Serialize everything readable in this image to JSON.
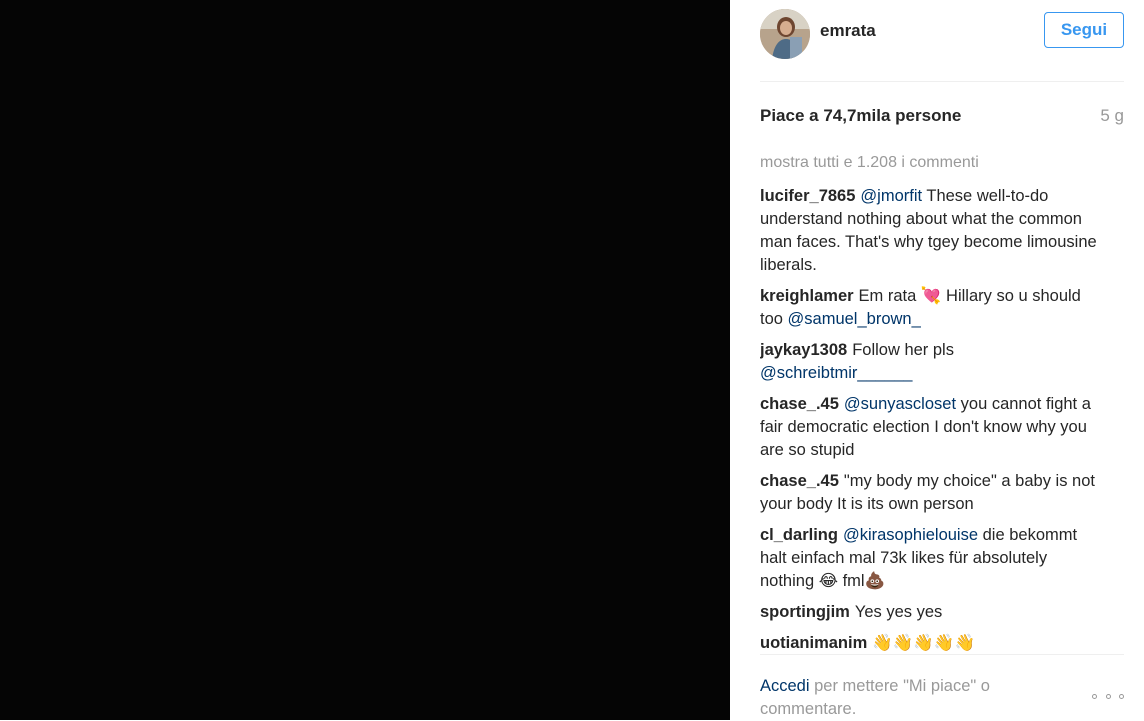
{
  "post": {
    "username": "emrata",
    "follow_label": "Segui",
    "likes": "Piace a 74,7mila persone",
    "age": "5 g",
    "show_all_comments": "mostra tutti e 1.208 i commenti"
  },
  "comments": [
    {
      "user": "lucifer_7865",
      "mention": "@jmorfit",
      "text": "These well-to-do understand nothing about what the common man faces. That's why tgey become limousine liberals."
    },
    {
      "user": "kreighlamer",
      "text": "Em rata 💘 Hillary so u should too",
      "mention_after": "@samuel_brown_"
    },
    {
      "user": "jaykay1308",
      "text": "Follow her pls",
      "mention_after": "@schreibtmir______"
    },
    {
      "user": "chase_.45",
      "mention": "@sunyascloset",
      "text": "you cannot fight a fair democratic election I don't know why you are so stupid"
    },
    {
      "user": "chase_.45",
      "text": "\"my body my choice\" a baby is not your body It is its own person"
    },
    {
      "user": "cl_darling",
      "mention": "@kirasophielouise",
      "text": "die bekommt halt einfach mal 73k likes für absolutely nothing 😂 fml💩"
    },
    {
      "user": "sportingjim",
      "text": "Yes yes yes"
    },
    {
      "user": "uotianimanim",
      "text": "👋👋👋👋👋"
    }
  ],
  "footer": {
    "login_link": "Accedi",
    "login_text": " per mettere \"Mi piace\" o commentare."
  },
  "icons": {
    "avatar": "profile-photo",
    "more": "more-options-icon"
  }
}
